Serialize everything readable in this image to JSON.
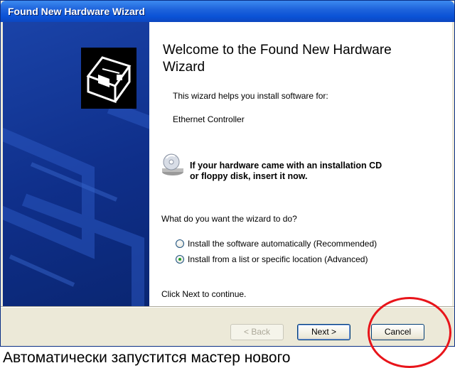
{
  "window": {
    "title": "Found New Hardware Wizard"
  },
  "content": {
    "heading": "Welcome to the Found New Hardware Wizard",
    "intro": "This wizard helps you install software for:",
    "device": "Ethernet Controller",
    "cd_message_line1": "If your hardware came with an installation CD",
    "cd_message_line2": "or floppy disk, insert it now.",
    "question": "What do you want the wizard to do?",
    "options": [
      {
        "label": "Install the software automatically (Recommended)",
        "checked": false
      },
      {
        "label": "Install from a list or specific location (Advanced)",
        "checked": true
      }
    ],
    "footer_hint": "Click Next to continue."
  },
  "buttons": {
    "back": "< Back",
    "next": "Next >",
    "cancel": "Cancel"
  },
  "caption": "Автоматически запустится мастер нового",
  "colors": {
    "titlebar": "#0a52d6",
    "side_panel": "#0f2f8a",
    "dialog_bg": "#ece9d8",
    "annotation": "#e8141a"
  },
  "icons": [
    "wizard-hardware-icon",
    "cd-drive-icon"
  ]
}
